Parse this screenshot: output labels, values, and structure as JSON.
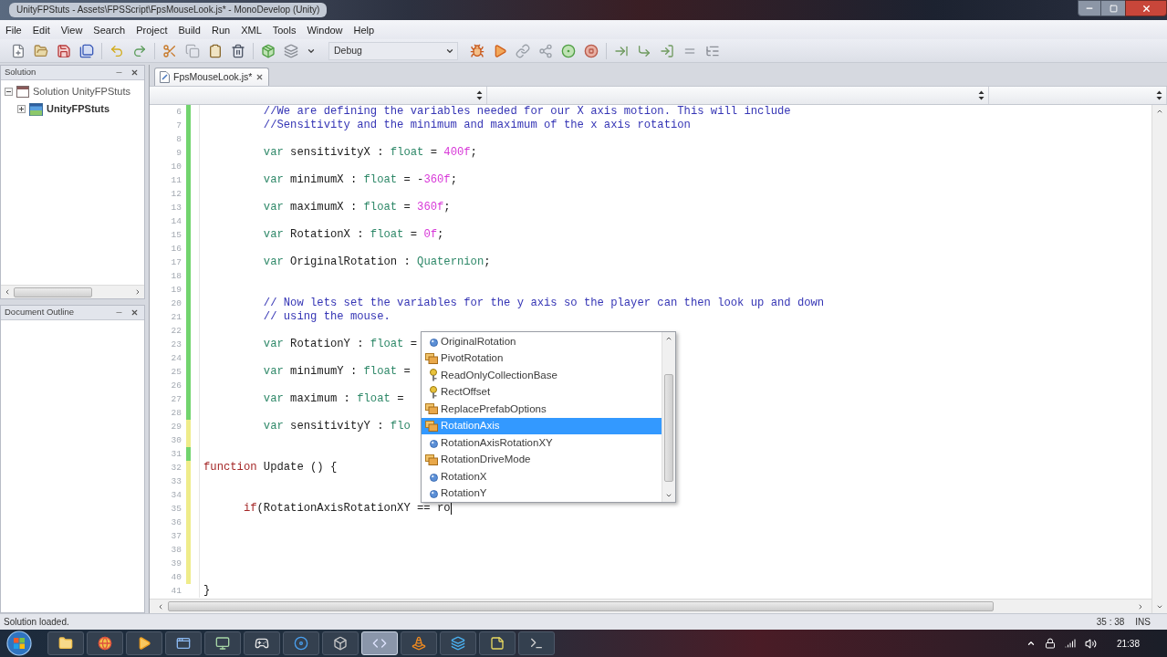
{
  "window": {
    "title": "UnityFPStuts - Assets\\FPSScript\\FpsMouseLook.js* - MonoDevelop (Unity)"
  },
  "menu": [
    "File",
    "Edit",
    "View",
    "Search",
    "Project",
    "Build",
    "Run",
    "XML",
    "Tools",
    "Window",
    "Help"
  ],
  "toolbar": {
    "configuration": "Debug"
  },
  "solution_pad": {
    "title": "Solution",
    "tree": [
      {
        "label": "Solution UnityFPStuts",
        "kind": "solution",
        "expanded": true,
        "children": [
          {
            "label": "UnityFPStuts",
            "kind": "project",
            "expanded": false,
            "startup": true
          }
        ]
      }
    ]
  },
  "outline_pad": {
    "title": "Document Outline"
  },
  "editor": {
    "tabs": [
      {
        "label": "FpsMouseLook.js*",
        "selected": true
      }
    ],
    "lines": [
      {
        "n": "6",
        "color": "#72d46e",
        "cursor": false,
        "tokens": [
          {
            "kind": "comment",
            "text": "         //We are defining the variables needed for our X axis motion. This will include"
          }
        ]
      },
      {
        "n": "7",
        "color": "#72d46e",
        "cursor": false,
        "tokens": [
          {
            "kind": "comment",
            "text": "         //Sensitivity and the minimum and maximum of the x axis rotation"
          }
        ]
      },
      {
        "n": "8",
        "color": "#72d46e",
        "cursor": false
      },
      {
        "n": "9",
        "color": "#72d46e",
        "cursor": false,
        "tokens": [
          {
            "kind": "declaration",
            "text": "         var"
          },
          {
            "kind": "plain",
            "text": " sensitivityX : "
          },
          {
            "kind": "type",
            "text": "float"
          },
          {
            "kind": "plain",
            "text": " = "
          },
          {
            "kind": "number",
            "text": "400f"
          },
          {
            "kind": "plain",
            "text": ";"
          }
        ]
      },
      {
        "n": "10",
        "color": "#72d46e",
        "cursor": false
      },
      {
        "n": "11",
        "color": "#72d46e",
        "cursor": false,
        "tokens": [
          {
            "kind": "declaration",
            "text": "         var"
          },
          {
            "kind": "plain",
            "text": " minimumX : "
          },
          {
            "kind": "type",
            "text": "float"
          },
          {
            "kind": "plain",
            "text": " = -"
          },
          {
            "kind": "number",
            "text": "360f"
          },
          {
            "kind": "plain",
            "text": ";"
          }
        ]
      },
      {
        "n": "12",
        "color": "#72d46e",
        "cursor": false
      },
      {
        "n": "13",
        "color": "#72d46e",
        "cursor": false,
        "tokens": [
          {
            "kind": "declaration",
            "text": "         var"
          },
          {
            "kind": "plain",
            "text": " maximumX : "
          },
          {
            "kind": "type",
            "text": "float"
          },
          {
            "kind": "plain",
            "text": " = "
          },
          {
            "kind": "number",
            "text": "360f"
          },
          {
            "kind": "plain",
            "text": ";"
          }
        ]
      },
      {
        "n": "14",
        "color": "#72d46e",
        "cursor": false
      },
      {
        "n": "15",
        "color": "#72d46e",
        "cursor": false,
        "tokens": [
          {
            "kind": "declaration",
            "text": "         var"
          },
          {
            "kind": "plain",
            "text": " RotationX : "
          },
          {
            "kind": "type",
            "text": "float"
          },
          {
            "kind": "plain",
            "text": " = "
          },
          {
            "kind": "number",
            "text": "0f"
          },
          {
            "kind": "plain",
            "text": ";"
          }
        ]
      },
      {
        "n": "16",
        "color": "#72d46e",
        "cursor": false
      },
      {
        "n": "17",
        "color": "#72d46e",
        "cursor": false,
        "tokens": [
          {
            "kind": "declaration",
            "text": "         var"
          },
          {
            "kind": "plain",
            "text": " OriginalRotation : "
          },
          {
            "kind": "type",
            "text": "Quaternion"
          },
          {
            "kind": "plain",
            "text": ";"
          }
        ]
      },
      {
        "n": "18",
        "color": "#72d46e",
        "cursor": false
      },
      {
        "n": "19",
        "color": "#72d46e",
        "cursor": false
      },
      {
        "n": "20",
        "color": "#72d46e",
        "cursor": false,
        "tokens": [
          {
            "kind": "comment",
            "text": "         // Now lets set the variables for the y axis so the player can then look up and down"
          }
        ]
      },
      {
        "n": "21",
        "color": "#72d46e",
        "cursor": false,
        "tokens": [
          {
            "kind": "comment",
            "text": "         // using the mouse."
          }
        ]
      },
      {
        "n": "22",
        "color": "#72d46e",
        "cursor": false
      },
      {
        "n": "23",
        "color": "#72d46e",
        "cursor": false,
        "tokens": [
          {
            "kind": "declaration",
            "text": "         var"
          },
          {
            "kind": "plain",
            "text": " RotationY : "
          },
          {
            "kind": "type",
            "text": "float"
          },
          {
            "kind": "plain",
            "text": " ="
          }
        ]
      },
      {
        "n": "24",
        "color": "#72d46e",
        "cursor": false
      },
      {
        "n": "25",
        "color": "#72d46e",
        "cursor": false,
        "tokens": [
          {
            "kind": "declaration",
            "text": "         var"
          },
          {
            "kind": "plain",
            "text": " minimumY : "
          },
          {
            "kind": "type",
            "text": "float"
          },
          {
            "kind": "plain",
            "text": " ="
          }
        ]
      },
      {
        "n": "26",
        "color": "#72d46e",
        "cursor": false
      },
      {
        "n": "27",
        "color": "#72d46e",
        "cursor": false,
        "tokens": [
          {
            "kind": "declaration",
            "text": "         var"
          },
          {
            "kind": "plain",
            "text": " maximum : "
          },
          {
            "kind": "type",
            "text": "float"
          },
          {
            "kind": "plain",
            "text": " ="
          }
        ]
      },
      {
        "n": "28",
        "color": "#72d46e",
        "cursor": false
      },
      {
        "n": "29",
        "color": "#efec8a",
        "cursor": false,
        "tokens": [
          {
            "kind": "declaration",
            "text": "         var"
          },
          {
            "kind": "plain",
            "text": " sensitivityY : "
          },
          {
            "kind": "type",
            "text": "flo"
          }
        ]
      },
      {
        "n": "30",
        "color": "#efec8a",
        "cursor": false
      },
      {
        "n": "31",
        "color": "#72d46e",
        "cursor": false
      },
      {
        "n": "32",
        "color": "#efec8a",
        "cursor": false,
        "tokens": [
          {
            "kind": "keyword",
            "text": "function"
          },
          {
            "kind": "plain",
            "text": " Update () {"
          }
        ]
      },
      {
        "n": "33",
        "color": "#efec8a",
        "cursor": false
      },
      {
        "n": "34",
        "color": "#efec8a",
        "cursor": false
      },
      {
        "n": "35",
        "color": "#efec8a",
        "cursor": true,
        "tokens": [
          {
            "kind": "keyword",
            "text": "      if"
          },
          {
            "kind": "plain",
            "text": "(RotationAxisRotationXY == ro"
          }
        ]
      },
      {
        "n": "36",
        "color": "#efec8a",
        "cursor": false
      },
      {
        "n": "37",
        "color": "#efec8a",
        "cursor": false
      },
      {
        "n": "38",
        "color": "#efec8a",
        "cursor": false
      },
      {
        "n": "39",
        "color": "#efec8a",
        "cursor": false
      },
      {
        "n": "40",
        "color": "#efec8a",
        "cursor": false
      },
      {
        "n": "41",
        "cursor": false,
        "tokens": [
          {
            "kind": "plain",
            "text": "}"
          }
        ]
      }
    ],
    "completion": {
      "items": [
        {
          "label": "OriginalRotation",
          "kind": "field",
          "selected": false
        },
        {
          "label": "PivotRotation",
          "kind": "enum",
          "selected": false
        },
        {
          "label": "ReadOnlyCollectionBase",
          "kind": "class",
          "selected": false
        },
        {
          "label": "RectOffset",
          "kind": "class",
          "selected": false
        },
        {
          "label": "ReplacePrefabOptions",
          "kind": "enum",
          "selected": false
        },
        {
          "label": "RotationAxis",
          "kind": "enum",
          "selected": true
        },
        {
          "label": "RotationAxisRotationXY",
          "kind": "field",
          "selected": false
        },
        {
          "label": "RotationDriveMode",
          "kind": "enum",
          "selected": false
        },
        {
          "label": "RotationX",
          "kind": "field",
          "selected": false
        },
        {
          "label": "RotationY",
          "kind": "field",
          "selected": false
        }
      ]
    }
  },
  "status_bar": {
    "message": "Solution loaded.",
    "position": "35 : 38",
    "mode": "INS"
  },
  "taskbar": {
    "buttons": [
      {
        "selected": false
      },
      {
        "selected": false
      },
      {
        "selected": false
      },
      {
        "selected": false
      },
      {
        "selected": false
      },
      {
        "selected": false
      },
      {
        "selected": false
      },
      {
        "selected": false
      },
      {
        "selected": true
      },
      {
        "selected": false
      },
      {
        "selected": false
      },
      {
        "selected": false
      },
      {
        "selected": false
      }
    ],
    "clock": "21:38"
  }
}
